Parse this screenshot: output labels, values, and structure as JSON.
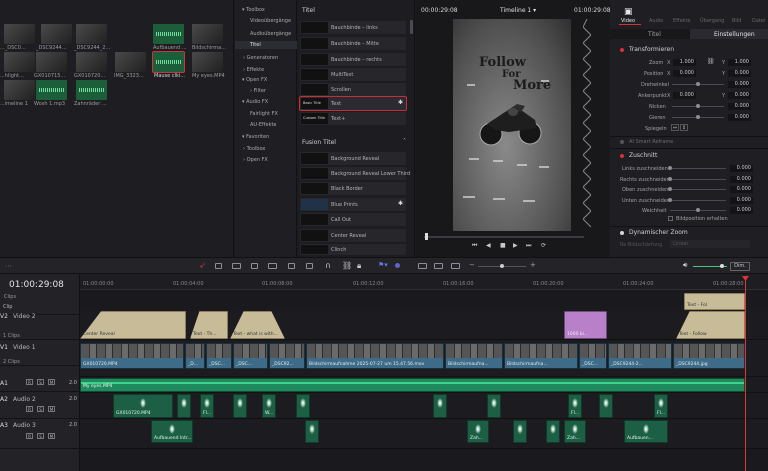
{
  "media_pool": {
    "row1": [
      {
        "label": "..._DSC0...",
        "kind": "vid"
      },
      {
        "label": "_DSC9244...",
        "kind": "vid"
      },
      {
        "label": "_DSC9244_2...",
        "kind": "vid"
      },
      {
        "label": "Aufbauend ...",
        "kind": "aud"
      },
      {
        "label": "Bildschirma...",
        "kind": "vid"
      }
    ],
    "row2": [
      {
        "label": "...hlight...",
        "kind": "vid"
      },
      {
        "label": "GX010715...",
        "kind": "vid"
      },
      {
        "label": "GX010720...",
        "kind": "vid"
      },
      {
        "label": "IMG_3323...",
        "kind": "vid"
      },
      {
        "label": "Mause clki...",
        "kind": "aud"
      },
      {
        "label": "My eyes.MP4",
        "kind": "vid"
      }
    ],
    "row3": [
      {
        "label": "...imeline 1",
        "kind": "vid"
      },
      {
        "label": "Wosh 1.mp3",
        "kind": "aud"
      },
      {
        "label": "Zahnräder ...",
        "kind": "aud"
      }
    ]
  },
  "fx_tree": {
    "items": [
      {
        "label": "Toolbox",
        "arrow": "▾"
      },
      {
        "label": "Videoübergänge",
        "arrow": ""
      },
      {
        "label": "Audioübergänge",
        "arrow": ""
      },
      {
        "label": "Titel",
        "arrow": ""
      },
      {
        "label": "Generatoren",
        "arrow": "›"
      },
      {
        "label": "Effekte",
        "arrow": "›"
      },
      {
        "label": "Open FX",
        "arrow": "▾"
      },
      {
        "label": "Filter",
        "arrow": "›"
      },
      {
        "label": "Audio FX",
        "arrow": "▾"
      },
      {
        "label": "Fairlight FX",
        "arrow": ""
      },
      {
        "label": "AU-Effekte",
        "arrow": ""
      },
      {
        "label": "Favoriten",
        "arrow": "▾"
      },
      {
        "label": "Toolbox",
        "arrow": "›"
      },
      {
        "label": "Open FX",
        "arrow": "›"
      }
    ]
  },
  "fx_list": {
    "titel_header": "Titel",
    "titles": [
      "Bauchbinde – links",
      "Bauchbinde – Mitte",
      "Bauchbinde – rechts",
      "MultiText",
      "Scrollen",
      "Text",
      "Text+"
    ],
    "text_thumb": "Basic Title",
    "textplus_thumb": "Custom Title",
    "fusion_header": "Fusion Titel",
    "fusion": [
      "Background Reveal",
      "Background Reveal Lower Third",
      "Black Border",
      "Blue Prints",
      "Call Out",
      "Center Reveal",
      "Clinch"
    ]
  },
  "viewer": {
    "tc_left": "00:00:29:08",
    "timeline_name": "Timeline 1",
    "tc_right": "01:00:29:08",
    "overlay_line1": "Follow",
    "overlay_line2": "For",
    "overlay_line3": "More"
  },
  "inspector": {
    "tabs": [
      "Video",
      "Audio",
      "Effekte",
      "Übergang",
      "Bild",
      "Datei"
    ],
    "title_partial": "Titel",
    "settings_tab": "Einstellungen",
    "transform_header": "Transformieren",
    "rows": [
      {
        "label": "Zoom",
        "x": "1.000",
        "y": "1.000"
      },
      {
        "label": "Position",
        "x": "0.000",
        "y": "0.000"
      },
      {
        "label": "Drehwinkel",
        "v": "0.000"
      },
      {
        "label": "Ankerpunkt",
        "x": "0.000",
        "y": "0.000"
      },
      {
        "label": "Nicken",
        "v": "0.000"
      },
      {
        "label": "Gieren",
        "v": "0.000"
      },
      {
        "label": "Spiegeln",
        "v": ""
      }
    ],
    "smart_reframe": "AI Smart Reframe",
    "crop_header": "Zuschnitt",
    "crop_rows": [
      {
        "label": "Links zuschneiden",
        "v": "0.000"
      },
      {
        "label": "Rechts zuschneiden",
        "v": "0.000"
      },
      {
        "label": "Oben zuschneiden",
        "v": "0.000"
      },
      {
        "label": "Unten zuschneiden",
        "v": "0.000"
      },
      {
        "label": "Weichheit",
        "v": "0.000"
      }
    ],
    "keep_pos": "Bildposition erhalten",
    "dyn_zoom": "Dynamischer Zoom",
    "dyn_zoom_sub": "Re-Bildschärfung",
    "dyn_zoom_val": "Linear"
  },
  "toolbar": {
    "dim": "Dim."
  },
  "timeline": {
    "timecode": "01:00:29:08",
    "clips_label": "Clips",
    "ruler": [
      "01:00:00:00",
      "01:00:04:00",
      "01:00:08:00",
      "01:00:12:00",
      "01:00:16:00",
      "01:00:20:00",
      "01:00:24:00",
      "01:00:28:00"
    ],
    "tracks": {
      "v3": {
        "id": "Clip",
        "name": ""
      },
      "v2": {
        "id": "V2",
        "name": "Video 2"
      },
      "v1": {
        "id": "V1",
        "name": "Video 1",
        "clips": "2 Clips"
      },
      "a1": {
        "id": "A1",
        "name": "",
        "vol": "2.0"
      },
      "a2": {
        "id": "A2",
        "name": "Audio 2",
        "vol": "2.0"
      },
      "a3": {
        "id": "A3",
        "name": "Audio 3",
        "vol": "2.0"
      }
    },
    "v2_clips": [
      "Center Reveal",
      "Text - Th...",
      "Text - what is with...",
      "1000 bi...",
      "Text - Fol",
      "Text - Follow"
    ],
    "v1_clips": [
      "GX010720.MP4",
      "_D...",
      "_DSC...",
      "_DSC...",
      "_DSC92...",
      "Bildschirmaufnahme 2025-07-27 um 15.47.56.mov",
      "Bildschirmaufna...",
      "Bildschirmaufna...",
      "_DSC...",
      "_DSC9244-2...",
      "_DSC9244.jpg"
    ],
    "a1_clip": "My eyes.MP4",
    "a2_clips": [
      "GX010720.MP4",
      "Fl...",
      "W...",
      "Fl...",
      "Fl..."
    ],
    "a3_clips": [
      "Aufbauend Intr...",
      "Zah...",
      "Zah...",
      "Aufbauen..."
    ]
  },
  "colors": {
    "accent": "#d4323a",
    "video_clip": "#3e6b87",
    "title_clip": "#c8bb98",
    "audio_clip": "#1d5f45",
    "purple_clip": "#b780c8"
  }
}
